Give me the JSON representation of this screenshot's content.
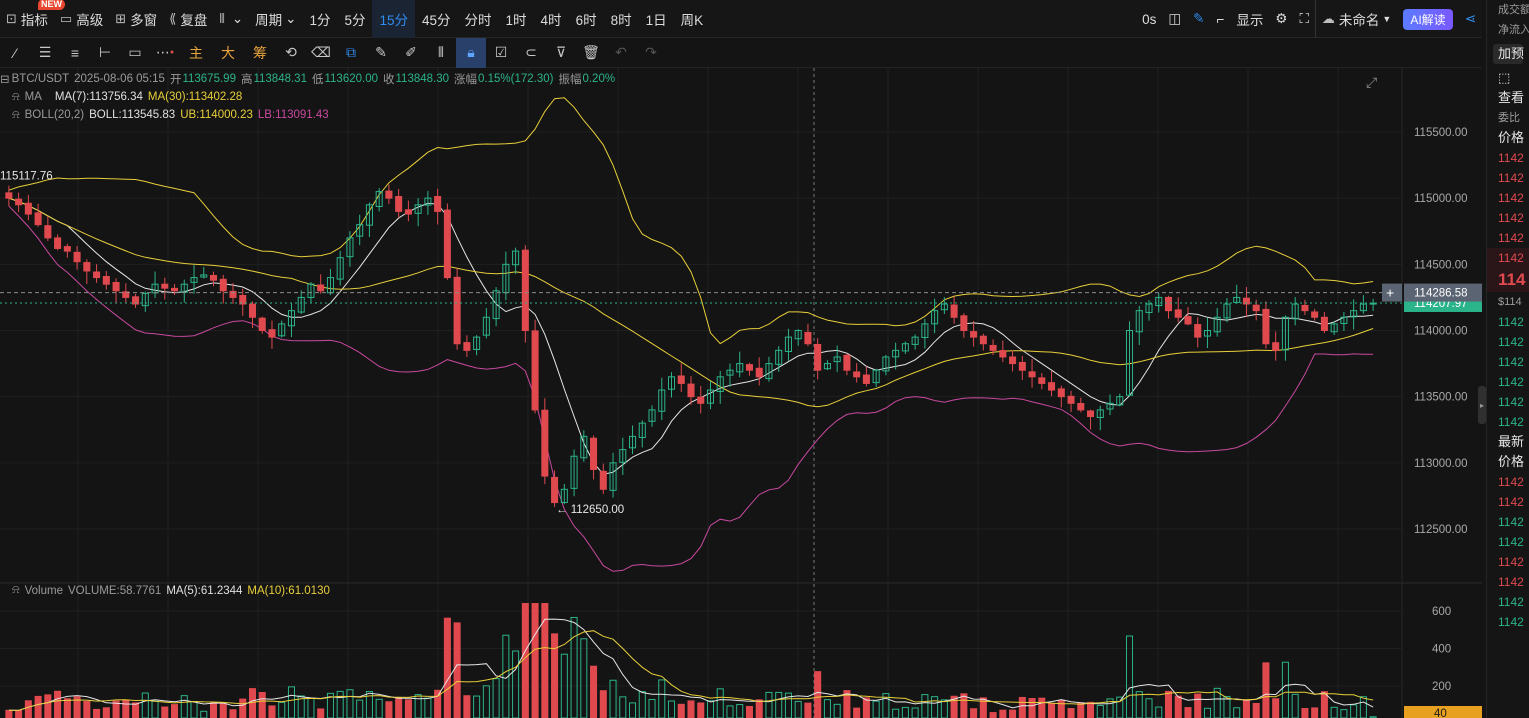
{
  "topbar": {
    "left": [
      {
        "label": "指标",
        "icon": "indicator-icon",
        "badge": "NEW"
      },
      {
        "label": "高级",
        "icon": "advanced-icon"
      },
      {
        "label": "多窗",
        "icon": "multi-window-icon"
      },
      {
        "label": "复盘",
        "icon": "replay-icon"
      },
      {
        "label": "",
        "icon": "chart-type-icon",
        "dropdown": true
      },
      {
        "label": "周期",
        "dropdown": true
      }
    ],
    "periods": [
      "1分",
      "5分",
      "15分",
      "45分",
      "分时",
      "1时",
      "4时",
      "6时",
      "8时",
      "1日",
      "周K"
    ],
    "active_period": "15分",
    "right": {
      "countdown": "0s",
      "display_label": "显示",
      "layout_name": "未命名",
      "ai_label": "AI解读"
    }
  },
  "toolbar": {
    "text_tools": [
      "主",
      "大",
      "筹"
    ]
  },
  "info": {
    "pair": "BTC/USDT",
    "time": "2025-08-06 05:15",
    "open_label": "开",
    "open": "113675.99",
    "high_label": "高",
    "high": "113848.31",
    "low_label": "低",
    "low": "113620.00",
    "close_label": "收",
    "close": "113848.30",
    "change_label": "涨幅",
    "change": "0.15%(172.30)",
    "amp_label": "振幅",
    "amp": "0.20%",
    "ma_name": "MA",
    "ma7": "MA(7):113756.34",
    "ma30": "MA(30):113402.28",
    "boll_name": "BOLL(20,2)",
    "boll": "BOLL:113545.83",
    "ub": "UB:114000.23",
    "lb": "LB:113091.43"
  },
  "volume_info": {
    "name": "Volume",
    "vol": "VOLUME:58.7761",
    "ma5": "MA(5):61.2344",
    "ma10": "MA(10):61.0130"
  },
  "chart_data": {
    "type": "candlestick",
    "price_axis_ticks": [
      "115500.00",
      "115000.00",
      "114500.00",
      "114000.00",
      "113500.00",
      "113000.00",
      "112500.00"
    ],
    "volume_axis_ticks": [
      "600",
      "400",
      "200"
    ],
    "ylim": [
      112250,
      115750
    ],
    "annotations": {
      "high": "115117.76",
      "low": "112650.00",
      "current_price": "114286.58",
      "last_price": "114207.97",
      "volume_tag": "40"
    },
    "colors": {
      "up": "#2bb48a",
      "down": "#e04a4f",
      "ma7": "#e6e6e6",
      "ma30": "#e8cf3a",
      "boll": "#e8cf3a",
      "lb": "#c949a0"
    },
    "close_series": [
      115000,
      114950,
      114880,
      114800,
      114700,
      114620,
      114600,
      114520,
      114450,
      114400,
      114350,
      114300,
      114250,
      114200,
      114280,
      114350,
      114320,
      114300,
      114350,
      114400,
      114420,
      114380,
      114300,
      114250,
      114200,
      114100,
      114000,
      113950,
      114050,
      114150,
      114250,
      114350,
      114300,
      114400,
      114550,
      114700,
      114800,
      114950,
      115050,
      115000,
      114900,
      114880,
      114950,
      115000,
      114900,
      114400,
      113900,
      113850,
      113950,
      114100,
      114300,
      114500,
      114600,
      114000,
      113400,
      112900,
      112700,
      112800,
      113050,
      113200,
      112950,
      112800,
      113000,
      113100,
      113200,
      113300,
      113400,
      113550,
      113650,
      113600,
      113500,
      113450,
      113550,
      113650,
      113700,
      113750,
      113700,
      113650,
      113750,
      113850,
      113950,
      114000,
      113900,
      113700,
      113750,
      113800,
      113700,
      113650,
      113600,
      113700,
      113800,
      113850,
      113900,
      113950,
      114050,
      114150,
      114200,
      114100,
      114000,
      113950,
      113900,
      113850,
      113800,
      113750,
      113700,
      113650,
      113600,
      113550,
      113500,
      113450,
      113400,
      113350,
      113400,
      113450,
      113500,
      114000,
      114150,
      114200,
      114250,
      114150,
      114100,
      114050,
      113950,
      114000,
      114100,
      114200,
      114250,
      114200,
      114150,
      113900,
      113850,
      114100,
      114200,
      114150,
      114100,
      114000,
      114050,
      114100,
      114150,
      114200,
      114207
    ]
  },
  "rightpanel": {
    "rows": [
      {
        "text": "成交额",
        "cls": "rp-small"
      },
      {
        "text": "净流入",
        "cls": "rp-small"
      },
      {
        "text": "加预",
        "cls": "rp-head"
      },
      {
        "text": "⬚",
        "cls": "rp-head"
      },
      {
        "text": "查看",
        "cls": "rp-head"
      },
      {
        "text": "委比",
        "cls": "rp-small"
      },
      {
        "text": "价格",
        "cls": "rp-head"
      },
      {
        "text": "1142",
        "cls": "r"
      },
      {
        "text": "1142",
        "cls": "r"
      },
      {
        "text": "1142",
        "cls": "r"
      },
      {
        "text": "1142",
        "cls": "r"
      },
      {
        "text": "1142",
        "cls": "r"
      },
      {
        "text": "1142",
        "cls": "r"
      },
      {
        "text": "114",
        "cls": "r"
      },
      {
        "text": "$114",
        "cls": "rp-small"
      },
      {
        "text": "1142",
        "cls": "g"
      },
      {
        "text": "1142",
        "cls": "g"
      },
      {
        "text": "1142",
        "cls": "g"
      },
      {
        "text": "1142",
        "cls": "g"
      },
      {
        "text": "1142",
        "cls": "g"
      },
      {
        "text": "1142",
        "cls": "g"
      },
      {
        "text": "最新",
        "cls": "rp-head"
      },
      {
        "text": "价格",
        "cls": "rp-head"
      },
      {
        "text": "1142",
        "cls": "r"
      },
      {
        "text": "1142",
        "cls": "r"
      },
      {
        "text": "1142",
        "cls": "g"
      },
      {
        "text": "1142",
        "cls": "g"
      },
      {
        "text": "1142",
        "cls": "r"
      },
      {
        "text": "1142",
        "cls": "r"
      },
      {
        "text": "1142",
        "cls": "g"
      },
      {
        "text": "1142",
        "cls": "g"
      }
    ]
  }
}
